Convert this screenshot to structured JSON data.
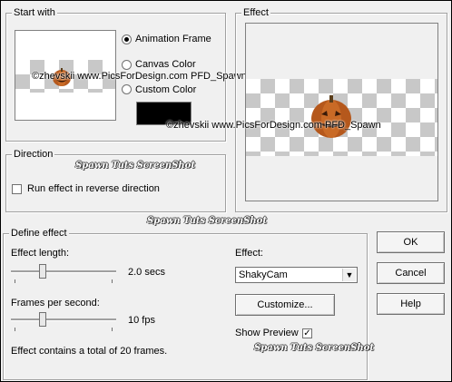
{
  "start_with": {
    "title": "Start with",
    "options": [
      "Animation Frame",
      "Canvas Color",
      "Custom Color"
    ],
    "selected": "Animation Frame",
    "custom_color": "#000000",
    "credit": "©zhevskii www.PicsForDesign.com PFD_Spawn"
  },
  "effect_preview": {
    "title": "Effect",
    "credit": "©zhevskii www.PicsForDesign.com PFD_Spawn"
  },
  "direction": {
    "title": "Direction",
    "reverse_label": "Run effect in reverse direction",
    "reverse_checked": false
  },
  "define_effect": {
    "title": "Define effect",
    "length_label": "Effect length:",
    "length_value": "2.0 secs",
    "fps_label": "Frames per second:",
    "fps_value": "10 fps",
    "total_text": "Effect contains a total of 20 frames.",
    "effect_label": "Effect:",
    "effect_selected": "ShakyCam",
    "customize_label": "Customize...",
    "show_preview_label": "Show Preview",
    "show_preview_checked": true
  },
  "buttons": {
    "ok": "OK",
    "cancel": "Cancel",
    "help": "Help"
  },
  "watermarks": {
    "direction": "Spawn Tuts ScreenShot",
    "define": "Spawn Tuts ScreenShot",
    "preview": "Spawn Tuts ScreenShot"
  },
  "icons": {
    "dropdown": "chevron-down-icon",
    "checkmark": "checkmark-icon",
    "pumpkin": "pumpkin-image"
  }
}
